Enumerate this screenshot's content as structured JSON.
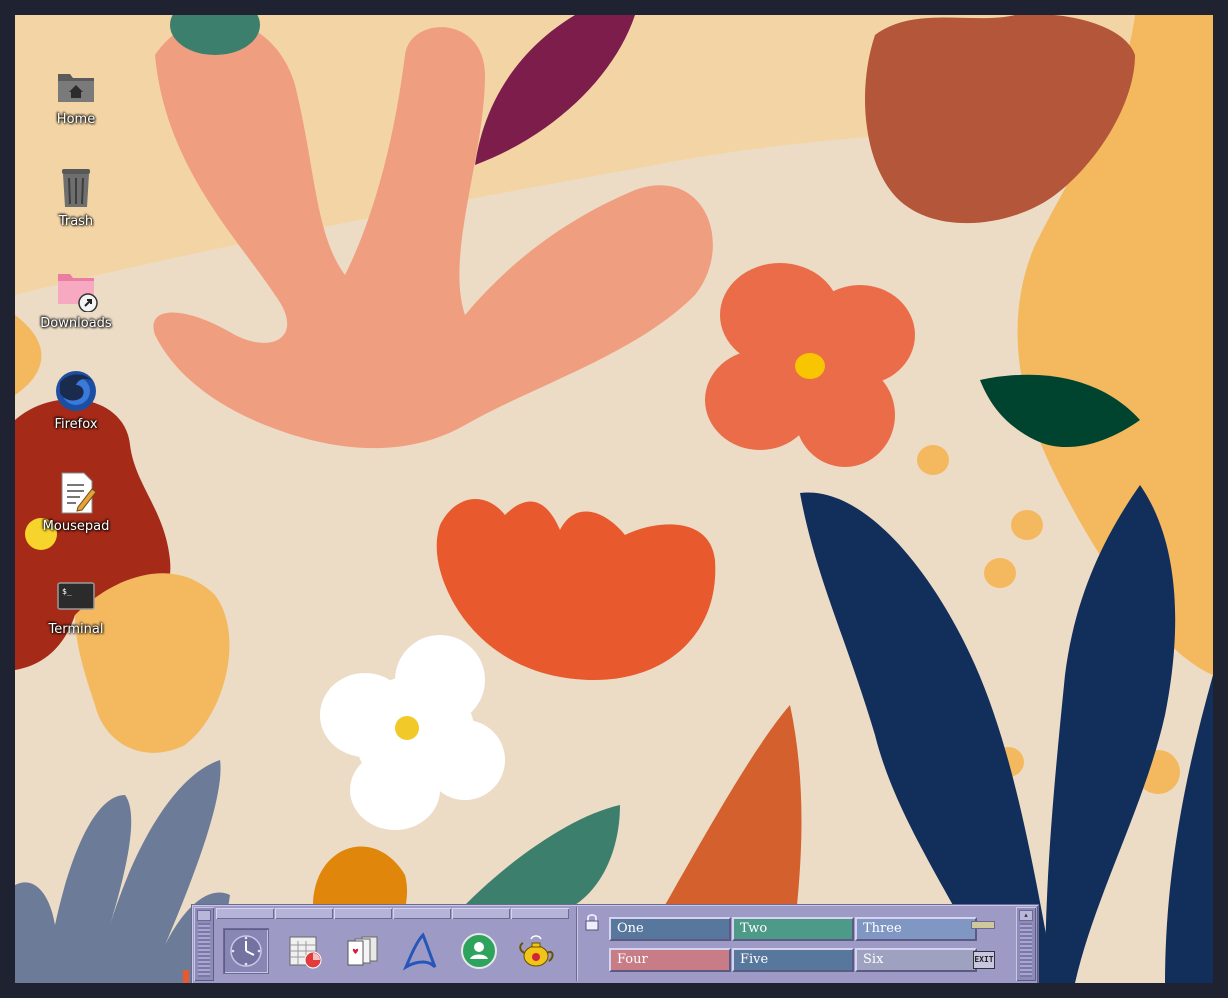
{
  "desktop": {
    "icons": [
      {
        "label": "Home",
        "icon": "home-folder-icon"
      },
      {
        "label": "Trash",
        "icon": "trash-icon"
      },
      {
        "label": "Downloads",
        "icon": "downloads-folder-icon"
      },
      {
        "label": "Firefox",
        "icon": "firefox-icon"
      },
      {
        "label": "Mousepad",
        "icon": "text-editor-icon"
      },
      {
        "label": "Terminal",
        "icon": "terminal-icon"
      }
    ]
  },
  "panel": {
    "launchers": [
      {
        "icon": "clock-icon"
      },
      {
        "icon": "calendar-icon"
      },
      {
        "icon": "cards-game-icon"
      },
      {
        "icon": "app-finder-icon"
      },
      {
        "icon": "user-icon"
      },
      {
        "icon": "teapot-icon"
      }
    ],
    "workspaces": [
      {
        "label": "One",
        "color": "#58779c"
      },
      {
        "label": "Two",
        "color": "#4e9a88"
      },
      {
        "label": "Three",
        "color": "#7f97c2"
      },
      {
        "label": "Four",
        "color": "#c77c86"
      },
      {
        "label": "Five",
        "color": "#58779c"
      },
      {
        "label": "Six",
        "color": "#9ea1bf"
      }
    ],
    "exit_label": "EXIT"
  }
}
